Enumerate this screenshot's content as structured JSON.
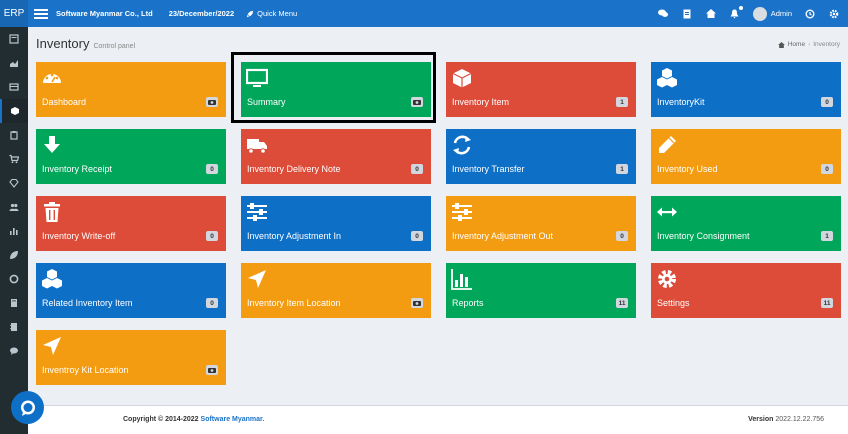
{
  "topbar": {
    "brand": "ERP",
    "company": "Software Myanmar Co., Ltd",
    "date": "23/December/2022",
    "quick_menu": "Quick Menu",
    "user": "Admin"
  },
  "header": {
    "title": "Inventory",
    "subtitle": "Control panel",
    "breadcrumb": {
      "home": "Home",
      "sep": "›",
      "current": "Inventory"
    }
  },
  "tiles": [
    {
      "label": "Dashboard",
      "count": "",
      "color": "#f39c12",
      "icon": "dashboard-icon"
    },
    {
      "label": "Summary",
      "count": "",
      "color": "#00a65a",
      "icon": "monitor-icon"
    },
    {
      "label": "Inventory Item",
      "count": "1",
      "color": "#dd4b39",
      "icon": "cube-icon"
    },
    {
      "label": "InventoryKit",
      "count": "0",
      "color": "#0e6fc7",
      "icon": "cubes-icon"
    },
    {
      "label": "Inventory Receipt",
      "count": "0",
      "color": "#00a65a",
      "icon": "arrow-down-icon"
    },
    {
      "label": "Inventory Delivery Note",
      "count": "0",
      "color": "#dd4b39",
      "icon": "truck-icon"
    },
    {
      "label": "Inventory Transfer",
      "count": "1",
      "color": "#0e6fc7",
      "icon": "refresh-icon"
    },
    {
      "label": "Inventory Used",
      "count": "0",
      "color": "#f39c12",
      "icon": "pencil-icon"
    },
    {
      "label": "Inventory Write-off",
      "count": "0",
      "color": "#dd4b39",
      "icon": "trash-icon"
    },
    {
      "label": "Inventory Adjustment In",
      "count": "0",
      "color": "#0e6fc7",
      "icon": "sliders-icon"
    },
    {
      "label": "Inventory Adjustment Out",
      "count": "0",
      "color": "#f39c12",
      "icon": "sliders-icon"
    },
    {
      "label": "Inventory Consignment",
      "count": "1",
      "color": "#00a65a",
      "icon": "arrows-h-icon"
    },
    {
      "label": "Related Inventory Item",
      "count": "0",
      "color": "#0e6fc7",
      "icon": "cubes-icon"
    },
    {
      "label": "Inventory Item Location",
      "count": "",
      "color": "#f39c12",
      "icon": "location-arrow-icon"
    },
    {
      "label": "Reports",
      "count": "11",
      "color": "#00a65a",
      "icon": "bar-chart-icon"
    },
    {
      "label": "Settings",
      "count": "11",
      "color": "#dd4b39",
      "icon": "gear-icon"
    },
    {
      "label": "Inventroy Kit Location",
      "count": "",
      "color": "#f39c12",
      "icon": "location-arrow-icon"
    }
  ],
  "footer": {
    "copyright": "Copyright © 2014-2022 ",
    "company_link": "Software Myanmar.",
    "version_label": "Version",
    "version": " 2022.12.22.756"
  }
}
